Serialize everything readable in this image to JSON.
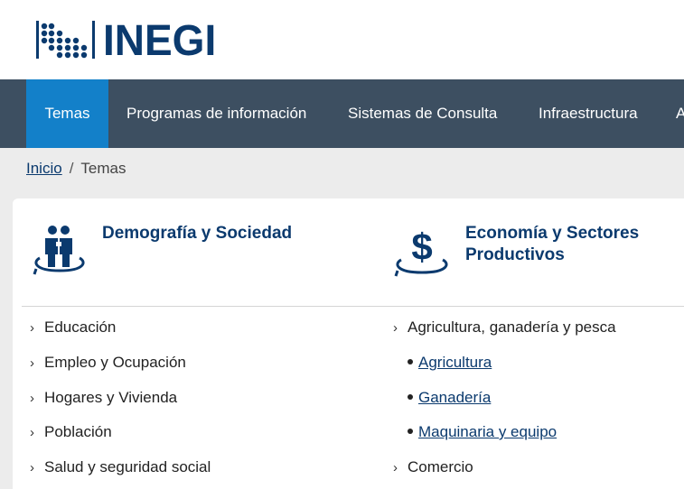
{
  "header": {
    "logo_text": "INEGI"
  },
  "nav": {
    "items": [
      {
        "label": "Temas"
      },
      {
        "label": "Programas de información"
      },
      {
        "label": "Sistemas de Consulta"
      },
      {
        "label": "Infraestructura"
      },
      {
        "label": "A"
      }
    ],
    "active_color": "#1380c9",
    "bar_color": "#3d4f61"
  },
  "breadcrumb": {
    "home": "Inicio",
    "separator": "/",
    "current": "Temas"
  },
  "categories": [
    {
      "title": "Demografía y Sociedad",
      "icon": "people-icon",
      "items": [
        "Educación",
        "Empleo y Ocupación",
        "Hogares y Vivienda",
        "Población",
        "Salud y seguridad social"
      ]
    },
    {
      "title_line1": "Economía y Sectores",
      "title_line2": "Productivos",
      "icon": "dollar-icon",
      "items": [
        {
          "label": "Agricultura, ganadería y pesca",
          "expanded": true,
          "subitems": [
            "Agricultura",
            "Ganadería",
            "Maquinaria y equipo"
          ]
        },
        {
          "label": "Comercio"
        }
      ]
    }
  ],
  "colors": {
    "brand": "#0b3a6e"
  }
}
